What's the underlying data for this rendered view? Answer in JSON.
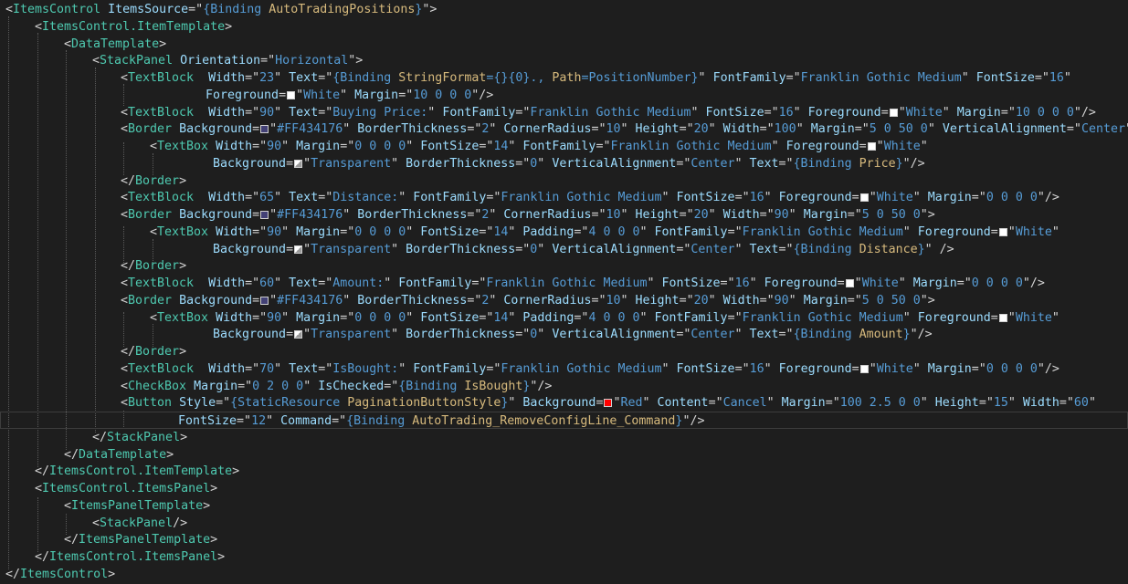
{
  "lines": [
    [
      "<",
      "tag:ItemsControl",
      " ",
      "attr:ItemsSource",
      "=\"",
      "val:{Binding ",
      "bind:AutoTradingPositions",
      "val:}",
      "\">"
    ],
    [
      "<",
      "tag:ItemsControl.ItemTemplate",
      ">"
    ],
    [
      "<",
      "tag:DataTemplate",
      ">"
    ],
    [
      "<",
      "tag:StackPanel",
      " ",
      "attr:Orientation",
      "=\"",
      "val:Horizontal",
      "\">"
    ],
    [
      "<",
      "tag:TextBlock",
      "  ",
      "attr:Width",
      "=\"",
      "val:23",
      "\" ",
      "attr:Text",
      "=\"",
      "val:{Binding ",
      "bind:StringFormat",
      "val:={}{0}., ",
      "bind:Path",
      "val:=PositionNumber}",
      "\" ",
      "attr:FontFamily",
      "=\"",
      "val:Franklin Gothic Medium",
      "\" ",
      "attr:FontSize",
      "=\"",
      "val:16",
      "\""
    ],
    [
      "attr:Foreground",
      "=",
      {
        "swatch": "#ffffff"
      },
      "\"",
      "val:White",
      "\" ",
      "attr:Margin",
      "=\"",
      "val:10 0 0 0",
      "\"/>"
    ],
    [
      "<",
      "tag:TextBlock",
      "  ",
      "attr:Width",
      "=\"",
      "val:90",
      "\" ",
      "attr:Text",
      "=\"",
      "val:Buying Price:",
      "\" ",
      "attr:FontFamily",
      "=\"",
      "val:Franklin Gothic Medium",
      "\" ",
      "attr:FontSize",
      "=\"",
      "val:16",
      "\" ",
      "attr:Foreground",
      "=",
      {
        "swatch": "#ffffff"
      },
      "\"",
      "val:White",
      "\" ",
      "attr:Margin",
      "=\"",
      "val:10 0 0 0",
      "\"/>"
    ],
    [
      "<",
      "tag:Border",
      " ",
      "attr:Background",
      "=",
      {
        "swatch": "#434176"
      },
      "\"",
      "val:#FF434176",
      "\" ",
      "attr:BorderThickness",
      "=\"",
      "val:2",
      "\" ",
      "attr:CornerRadius",
      "=\"",
      "val:10",
      "\" ",
      "attr:Height",
      "=\"",
      "val:20",
      "\" ",
      "attr:Width",
      "=\"",
      "val:100",
      "\" ",
      "attr:Margin",
      "=\"",
      "val:5 0 50 0",
      "\" ",
      "attr:VerticalAlignment",
      "=\"",
      "val:Center",
      "\">"
    ],
    [
      "<",
      "tag:TextBox",
      " ",
      "attr:Width",
      "=\"",
      "val:90",
      "\" ",
      "attr:Margin",
      "=\"",
      "val:0 0 0 0",
      "\" ",
      "attr:FontSize",
      "=\"",
      "val:14",
      "\" ",
      "attr:FontFamily",
      "=\"",
      "val:Franklin Gothic Medium",
      "\" ",
      "attr:Foreground",
      "=",
      {
        "swatch": "#ffffff"
      },
      "\"",
      "val:White",
      "\""
    ],
    [
      "attr:Background",
      "=",
      {
        "swatch": "transparent"
      },
      "\"",
      "val:Transparent",
      "\" ",
      "attr:BorderThickness",
      "=\"",
      "val:0",
      "\" ",
      "attr:VerticalAlignment",
      "=\"",
      "val:Center",
      "\" ",
      "attr:Text",
      "=\"",
      "val:{Binding ",
      "bind:Price",
      "val:}",
      "\"/>"
    ],
    [
      "</",
      "tag:Border",
      ">"
    ],
    [
      "<",
      "tag:TextBlock",
      "  ",
      "attr:Width",
      "=\"",
      "val:65",
      "\" ",
      "attr:Text",
      "=\"",
      "val:Distance:",
      "\" ",
      "attr:FontFamily",
      "=\"",
      "val:Franklin Gothic Medium",
      "\" ",
      "attr:FontSize",
      "=\"",
      "val:16",
      "\" ",
      "attr:Foreground",
      "=",
      {
        "swatch": "#ffffff"
      },
      "\"",
      "val:White",
      "\" ",
      "attr:Margin",
      "=\"",
      "val:0 0 0 0",
      "\"/>"
    ],
    [
      "<",
      "tag:Border",
      " ",
      "attr:Background",
      "=",
      {
        "swatch": "#434176"
      },
      "\"",
      "val:#FF434176",
      "\" ",
      "attr:BorderThickness",
      "=\"",
      "val:2",
      "\" ",
      "attr:CornerRadius",
      "=\"",
      "val:10",
      "\" ",
      "attr:Height",
      "=\"",
      "val:20",
      "\" ",
      "attr:Width",
      "=\"",
      "val:90",
      "\" ",
      "attr:Margin",
      "=\"",
      "val:5 0 50 0",
      "\">"
    ],
    [
      "<",
      "tag:TextBox",
      " ",
      "attr:Width",
      "=\"",
      "val:90",
      "\" ",
      "attr:Margin",
      "=\"",
      "val:0 0 0 0",
      "\" ",
      "attr:FontSize",
      "=\"",
      "val:14",
      "\" ",
      "attr:Padding",
      "=\"",
      "val:4 0 0 0",
      "\" ",
      "attr:FontFamily",
      "=\"",
      "val:Franklin Gothic Medium",
      "\" ",
      "attr:Foreground",
      "=",
      {
        "swatch": "#ffffff"
      },
      "\"",
      "val:White",
      "\""
    ],
    [
      "attr:Background",
      "=",
      {
        "swatch": "transparent"
      },
      "\"",
      "val:Transparent",
      "\" ",
      "attr:BorderThickness",
      "=\"",
      "val:0",
      "\" ",
      "attr:VerticalAlignment",
      "=\"",
      "val:Center",
      "\" ",
      "attr:Text",
      "=\"",
      "val:{Binding ",
      "bind:Distance",
      "val:}",
      "\" />"
    ],
    [
      "</",
      "tag:Border",
      ">"
    ],
    [
      "<",
      "tag:TextBlock",
      "  ",
      "attr:Width",
      "=\"",
      "val:60",
      "\" ",
      "attr:Text",
      "=\"",
      "val:Amount:",
      "\" ",
      "attr:FontFamily",
      "=\"",
      "val:Franklin Gothic Medium",
      "\" ",
      "attr:FontSize",
      "=\"",
      "val:16",
      "\" ",
      "attr:Foreground",
      "=",
      {
        "swatch": "#ffffff"
      },
      "\"",
      "val:White",
      "\" ",
      "attr:Margin",
      "=\"",
      "val:0 0 0 0",
      "\"/>"
    ],
    [
      "<",
      "tag:Border",
      " ",
      "attr:Background",
      "=",
      {
        "swatch": "#434176"
      },
      "\"",
      "val:#FF434176",
      "\" ",
      "attr:BorderThickness",
      "=\"",
      "val:2",
      "\" ",
      "attr:CornerRadius",
      "=\"",
      "val:10",
      "\" ",
      "attr:Height",
      "=\"",
      "val:20",
      "\" ",
      "attr:Width",
      "=\"",
      "val:90",
      "\" ",
      "attr:Margin",
      "=\"",
      "val:5 0 50 0",
      "\">"
    ],
    [
      "<",
      "tag:TextBox",
      " ",
      "attr:Width",
      "=\"",
      "val:90",
      "\" ",
      "attr:Margin",
      "=\"",
      "val:0 0 0 0",
      "\" ",
      "attr:FontSize",
      "=\"",
      "val:14",
      "\" ",
      "attr:Padding",
      "=\"",
      "val:4 0 0 0",
      "\" ",
      "attr:FontFamily",
      "=\"",
      "val:Franklin Gothic Medium",
      "\" ",
      "attr:Foreground",
      "=",
      {
        "swatch": "#ffffff"
      },
      "\"",
      "val:White",
      "\""
    ],
    [
      "attr:Background",
      "=",
      {
        "swatch": "transparent"
      },
      "\"",
      "val:Transparent",
      "\" ",
      "attr:BorderThickness",
      "=\"",
      "val:0",
      "\" ",
      "attr:VerticalAlignment",
      "=\"",
      "val:Center",
      "\" ",
      "attr:Text",
      "=\"",
      "val:{Binding ",
      "bind:Amount",
      "val:}",
      "\"/>"
    ],
    [
      "</",
      "tag:Border",
      ">"
    ],
    [
      "<",
      "tag:TextBlock",
      "  ",
      "attr:Width",
      "=\"",
      "val:70",
      "\" ",
      "attr:Text",
      "=\"",
      "val:IsBought:",
      "\" ",
      "attr:FontFamily",
      "=\"",
      "val:Franklin Gothic Medium",
      "\" ",
      "attr:FontSize",
      "=\"",
      "val:16",
      "\" ",
      "attr:Foreground",
      "=",
      {
        "swatch": "#ffffff"
      },
      "\"",
      "val:White",
      "\" ",
      "attr:Margin",
      "=\"",
      "val:0 0 0 0",
      "\"/>"
    ],
    [
      "<",
      "tag:CheckBox",
      " ",
      "attr:Margin",
      "=\"",
      "val:0 2 0 0",
      "\" ",
      "attr:IsChecked",
      "=\"",
      "val:{Binding ",
      "bind:IsBought",
      "val:}",
      "\"/>"
    ],
    [
      "<",
      "tag:Button",
      " ",
      "attr:Style",
      "=\"",
      "val:{StaticResource ",
      "bind:PaginationButtonStyle",
      "val:}",
      "\" ",
      "attr:Background",
      "=",
      {
        "swatch": "#ff0000"
      },
      "\"",
      "val:Red",
      "\" ",
      "attr:Content",
      "=\"",
      "val:Cancel",
      "\" ",
      "attr:Margin",
      "=\"",
      "val:100 2.5 0 0",
      "\" ",
      "attr:Height",
      "=\"",
      "val:15",
      "\" ",
      "attr:Width",
      "=\"",
      "val:60",
      "\""
    ],
    [
      "attr:FontSize",
      "=\"",
      "val:12",
      "\" ",
      "attr:Command",
      "=\"",
      "val:{Binding ",
      "bind:AutoTrading_RemoveConfigLine_Command",
      "val:}",
      "\"/>"
    ],
    [
      "</",
      "tag:StackPanel",
      ">"
    ],
    [
      "</",
      "tag:DataTemplate",
      ">"
    ],
    [
      "</",
      "tag:ItemsControl.ItemTemplate",
      ">"
    ],
    [
      "<",
      "tag:ItemsControl.ItemsPanel",
      ">"
    ],
    [
      "<",
      "tag:ItemsPanelTemplate",
      ">"
    ],
    [
      "<",
      "tag:StackPanel",
      "/>"
    ],
    [
      "</",
      "tag:ItemsPanelTemplate",
      ">"
    ],
    [
      "</",
      "tag:ItemsControl.ItemsPanel",
      ">"
    ],
    [
      "</",
      "tag:ItemsControl",
      ">"
    ]
  ],
  "colors": {
    "background": "#1e1e1e",
    "bracket": "#d4d4d4",
    "element_name": "#4ec9b0",
    "attribute_name": "#9cdcfe",
    "attribute_value": "#569cd6",
    "binding_path": "#d7ba7d"
  }
}
